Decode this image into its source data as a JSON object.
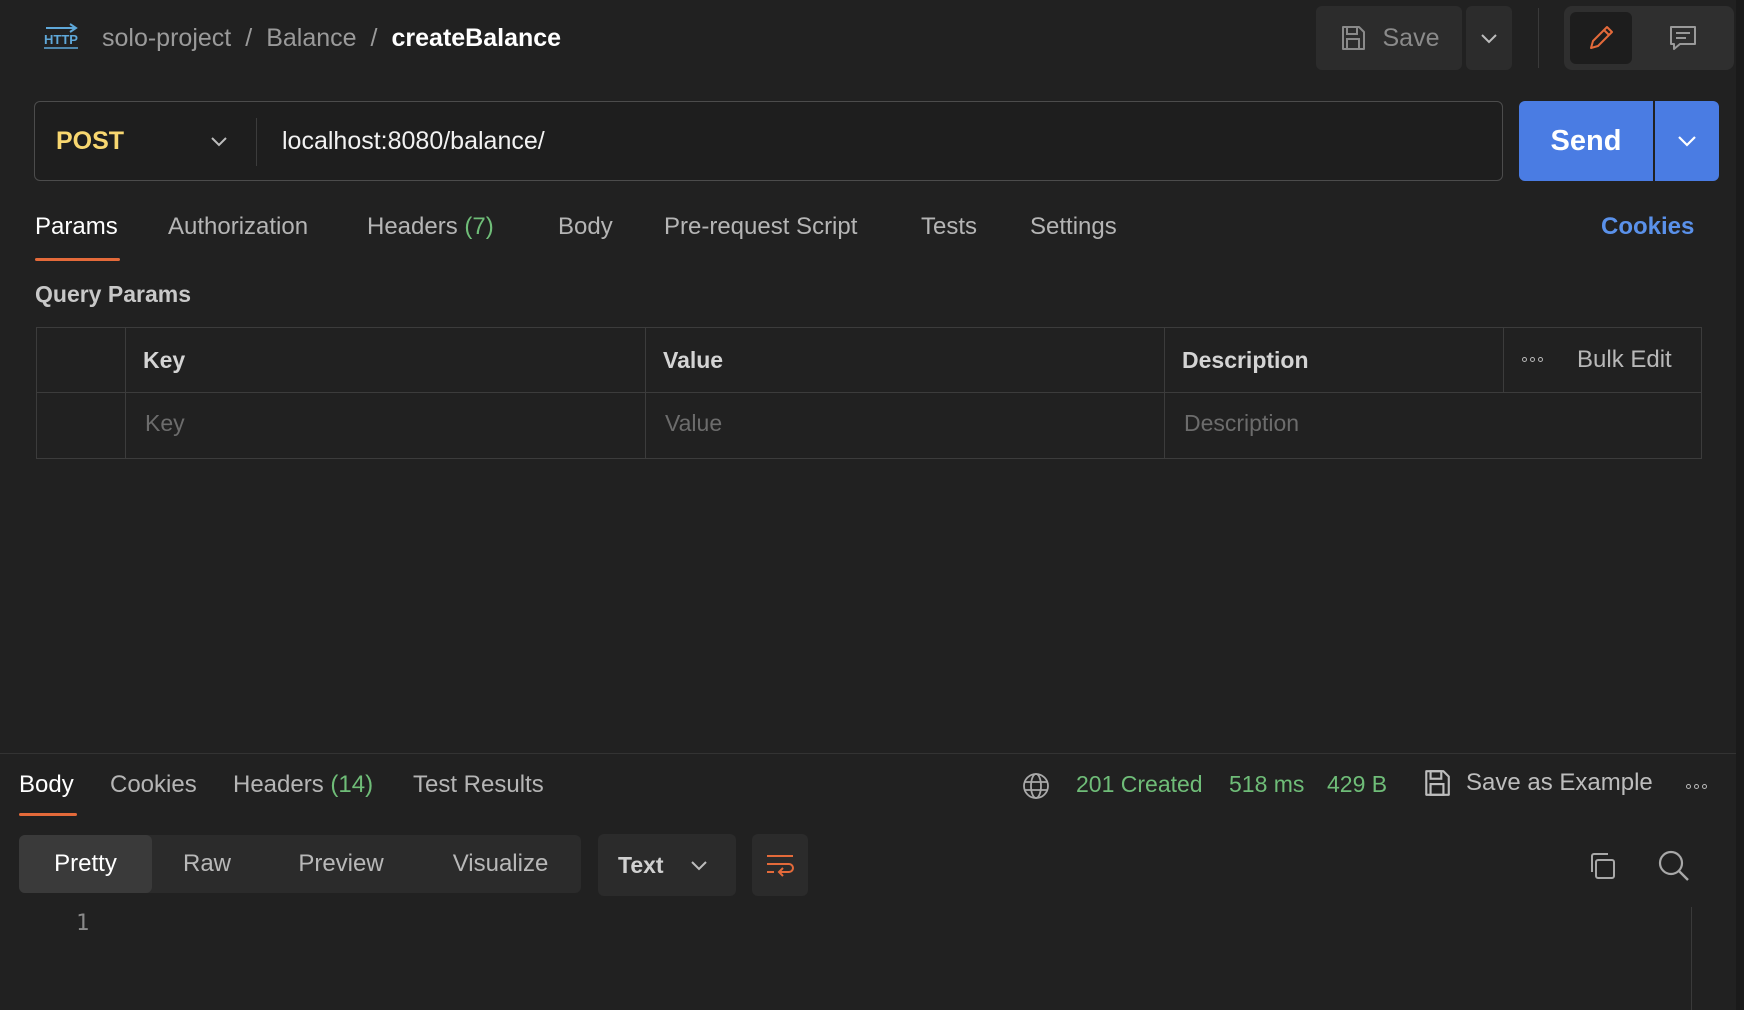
{
  "header": {
    "protocol_icon": "http-icon",
    "breadcrumb": {
      "collection": "solo-project",
      "folder": "Balance",
      "request": "createBalance",
      "separator": "/"
    },
    "save_label": "Save",
    "icons": {
      "save": "floppy-disk-icon",
      "caret": "chevron-down-icon",
      "edit": "pencil-icon",
      "docs": "documentation-icon"
    }
  },
  "request": {
    "method": "POST",
    "url": "localhost:8080/balance/",
    "send_label": "Send"
  },
  "request_tabs": {
    "params": "Params",
    "authorization": "Authorization",
    "headers": "Headers",
    "headers_count": "(7)",
    "body": "Body",
    "pre_request": "Pre-request Script",
    "tests": "Tests",
    "settings": "Settings",
    "cookies": "Cookies",
    "active": "Params"
  },
  "query_params": {
    "title": "Query Params",
    "columns": {
      "key": "Key",
      "value": "Value",
      "description": "Description"
    },
    "bulk_edit": "Bulk Edit",
    "placeholders": {
      "key": "Key",
      "value": "Value",
      "description": "Description"
    }
  },
  "response": {
    "tabs": {
      "body": "Body",
      "cookies": "Cookies",
      "headers": "Headers",
      "headers_count": "(14)",
      "test_results": "Test Results",
      "active": "Body"
    },
    "status": "201 Created",
    "time": "518 ms",
    "size": "429 B",
    "save_as_example": "Save as Example",
    "view_modes": {
      "pretty": "Pretty",
      "raw": "Raw",
      "preview": "Preview",
      "visualize": "Visualize",
      "active": "Pretty"
    },
    "format": "Text",
    "line_numbers": [
      "1"
    ],
    "icons": {
      "network": "globe-icon",
      "wrap": "wrap-lines-icon",
      "copy": "copy-icon",
      "search": "search-icon",
      "more": "more-dots-icon"
    }
  },
  "colors": {
    "accent": "#e46a3a",
    "method_post": "#f8d770",
    "send": "#4a7ce3",
    "status_ok": "#6fbd78",
    "link": "#5a91ea",
    "background": "#212121"
  }
}
